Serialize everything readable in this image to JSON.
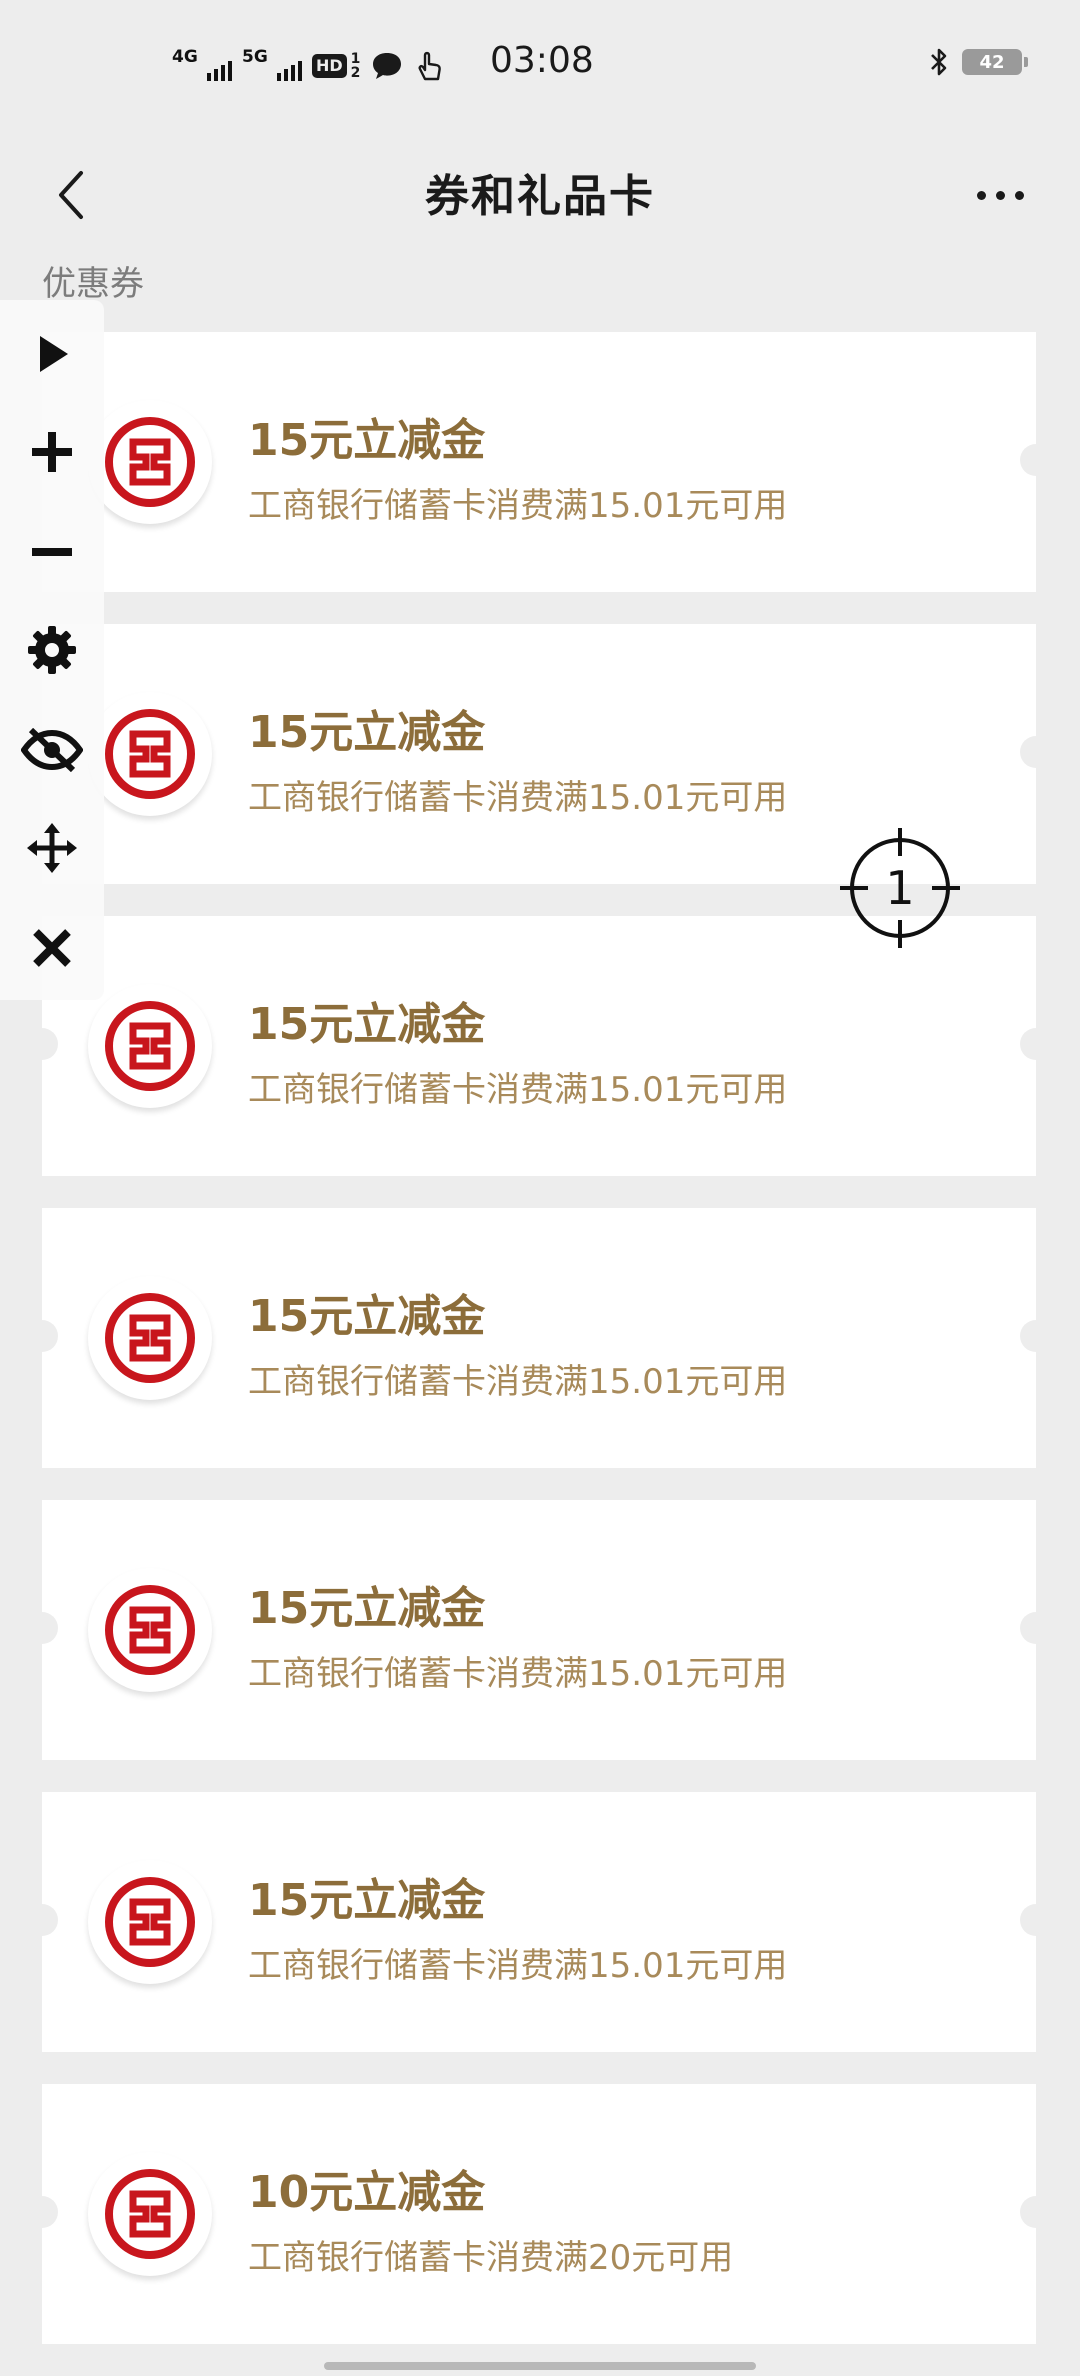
{
  "status_bar": {
    "net1": "4G",
    "net2": "5G",
    "hd": "HD",
    "hd_sub_top": "1",
    "hd_sub_bottom": "2",
    "time": "03:08",
    "battery": "42"
  },
  "nav": {
    "title": "券和礼品卡"
  },
  "section": {
    "label": "优惠券"
  },
  "coupons": [
    {
      "title": "15元立减金",
      "desc": "工商银行储蓄卡消费满15.01元可用"
    },
    {
      "title": "15元立减金",
      "desc": "工商银行储蓄卡消费满15.01元可用"
    },
    {
      "title": "15元立减金",
      "desc": "工商银行储蓄卡消费满15.01元可用"
    },
    {
      "title": "15元立减金",
      "desc": "工商银行储蓄卡消费满15.01元可用"
    },
    {
      "title": "15元立减金",
      "desc": "工商银行储蓄卡消费满15.01元可用"
    },
    {
      "title": "15元立减金",
      "desc": "工商银行储蓄卡消费满15.01元可用"
    },
    {
      "title": "10元立减金",
      "desc": "工商银行储蓄卡消费满20元可用"
    }
  ],
  "crosshair": {
    "label": "1"
  },
  "colors": {
    "accent_gold": "#8c6d3a",
    "desc_gold": "#a88a5a",
    "icbc_red": "#c8161d",
    "background": "#ededed"
  },
  "icons": [
    "back-chevron-icon",
    "more-dots-icon",
    "icbc-logo-icon",
    "play-icon",
    "plus-icon",
    "minus-icon",
    "gear-icon",
    "eye-off-icon",
    "move-icon",
    "close-icon",
    "crosshair-icon"
  ]
}
